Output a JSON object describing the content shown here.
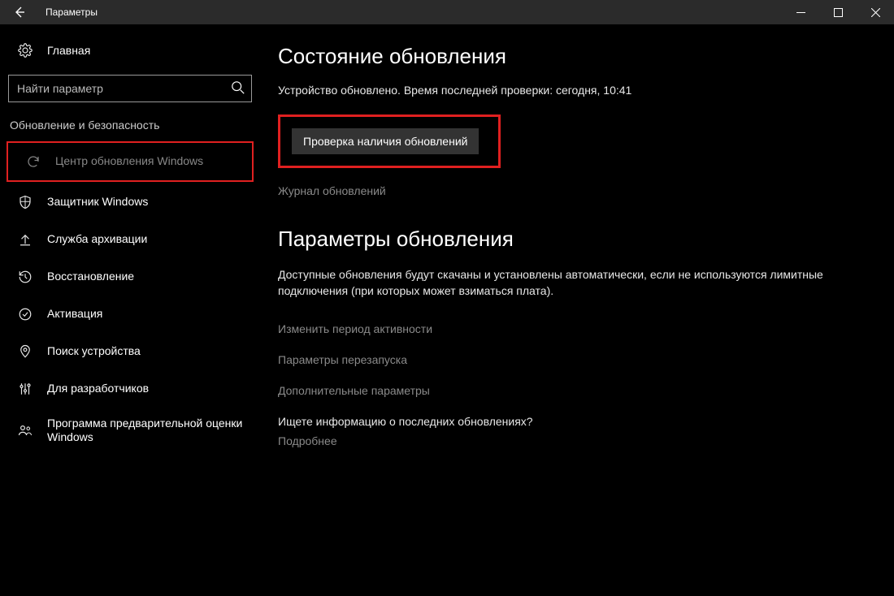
{
  "titlebar": {
    "title": "Параметры"
  },
  "sidebar": {
    "home": "Главная",
    "search_placeholder": "Найти параметр",
    "section": "Обновление и безопасность",
    "items": [
      {
        "label": "Центр обновления Windows"
      },
      {
        "label": "Защитник Windows"
      },
      {
        "label": "Служба архивации"
      },
      {
        "label": "Восстановление"
      },
      {
        "label": "Активация"
      },
      {
        "label": "Поиск устройства"
      },
      {
        "label": "Для разработчиков"
      },
      {
        "label": "Программа предварительной оценки Windows"
      }
    ]
  },
  "main": {
    "status_heading": "Состояние обновления",
    "status_text": "Устройство обновлено. Время последней проверки: сегодня, 10:41",
    "check_button": "Проверка наличия обновлений",
    "history_link": "Журнал обновлений",
    "params_heading": "Параметры обновления",
    "params_body": "Доступные обновления будут скачаны и установлены автоматически, если не используются лимитные подключения (при которых может взиматься плата).",
    "link_activity": "Изменить период активности",
    "link_restart": "Параметры перезапуска",
    "link_advanced": "Дополнительные параметры",
    "question": "Ищете информацию о последних обновлениях?",
    "more": "Подробнее"
  }
}
